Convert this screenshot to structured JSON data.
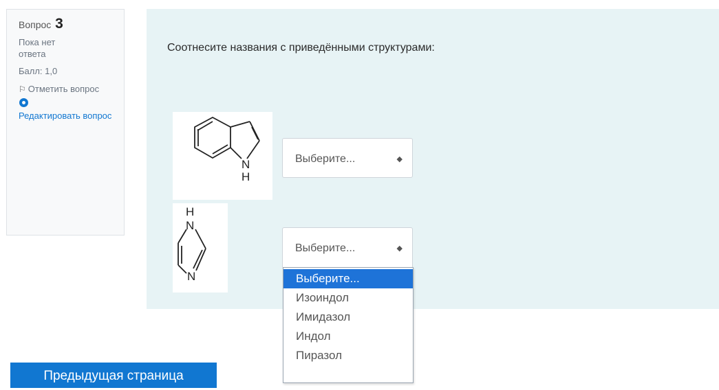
{
  "info": {
    "question_label": "Вопрос",
    "question_number": "3",
    "state": "Пока нет ответа",
    "grade": "Балл: 1,0",
    "flag_icon": "flag-icon",
    "flag_label": "Отметить вопрос",
    "edit_icon": "gear-icon",
    "edit_label": "Редактировать вопрос"
  },
  "question": {
    "text": "Соотнесите названия с приведёнными структурами:",
    "structures": [
      {
        "name": "indole-structure",
        "nh_label": "N\nH"
      },
      {
        "name": "imidazole-structure",
        "h_label": "H",
        "n_top": "N",
        "n_bottom": "N"
      }
    ],
    "select1_value": "Выберите...",
    "select2_value": "Выберите...",
    "dropdown_options": [
      "Выберите...",
      "Изоиндол",
      "Имидазол",
      "Индол",
      "Пиразол"
    ]
  },
  "nav": {
    "prev_label": "Предыдущая страница"
  }
}
